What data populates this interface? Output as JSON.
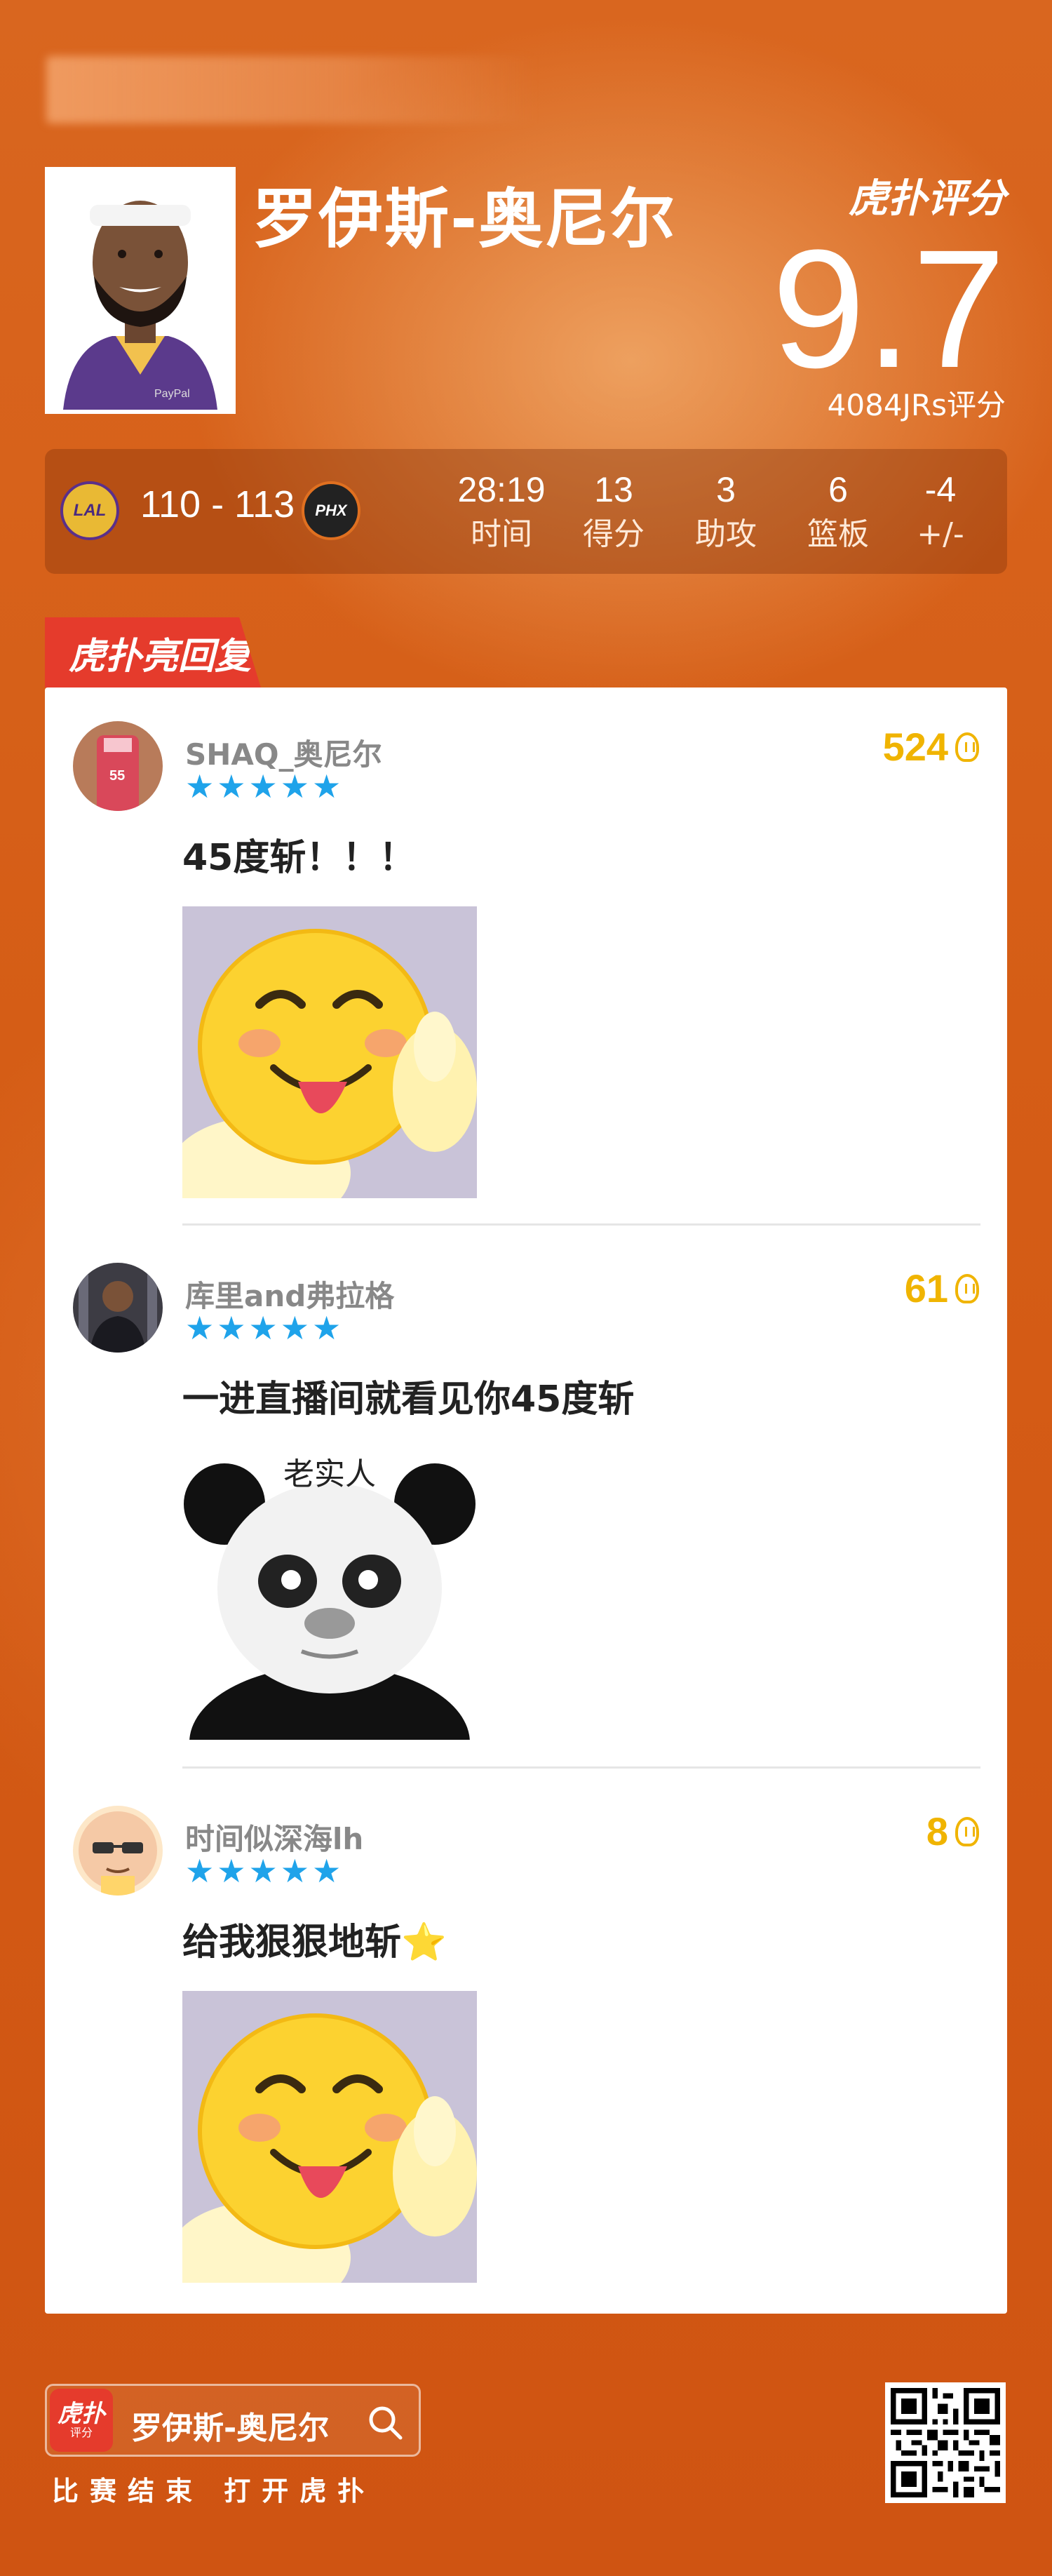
{
  "player": {
    "name": "罗伊斯-奥尼尔",
    "rating": "9.7",
    "rating_count": "4084JRs评分",
    "brand": "虎扑评分"
  },
  "game": {
    "home_team_icon": "LAL",
    "away_team_icon": "PHX",
    "score": "110 - 113",
    "stats": [
      {
        "value": "28:19",
        "label": "时间"
      },
      {
        "value": "13",
        "label": "得分"
      },
      {
        "value": "3",
        "label": "助攻"
      },
      {
        "value": "6",
        "label": "篮板"
      },
      {
        "value": "-4",
        "label": "+/-"
      }
    ]
  },
  "section_badge": "虎扑亮回复",
  "comments": [
    {
      "user": "SHAQ_奥尼尔",
      "stars": "★★★★★",
      "likes": "524",
      "text": "45度斩！！！",
      "image": "smiley-tongue-emoji"
    },
    {
      "user": "库里and弗拉格",
      "stars": "★★★★★",
      "likes": "61",
      "text": "一进直播间就看见你45度斩",
      "image_caption": "老实人"
    },
    {
      "user": "时间似深海lh",
      "stars": "★★★★★",
      "likes": "8",
      "text": "给我狠狠地斩⭐",
      "image": "smiley-tongue-emoji"
    }
  ],
  "footer": {
    "search_text": "罗伊斯-奥尼尔",
    "app_icon_main": "虎扑",
    "app_icon_sub": "评分",
    "cta": "比赛结束 打开虎扑"
  },
  "colors": {
    "background": "#d55d16",
    "badge_red": "#e53b2c",
    "star_blue": "#1fa3ea",
    "like_gold": "#f0b400"
  }
}
